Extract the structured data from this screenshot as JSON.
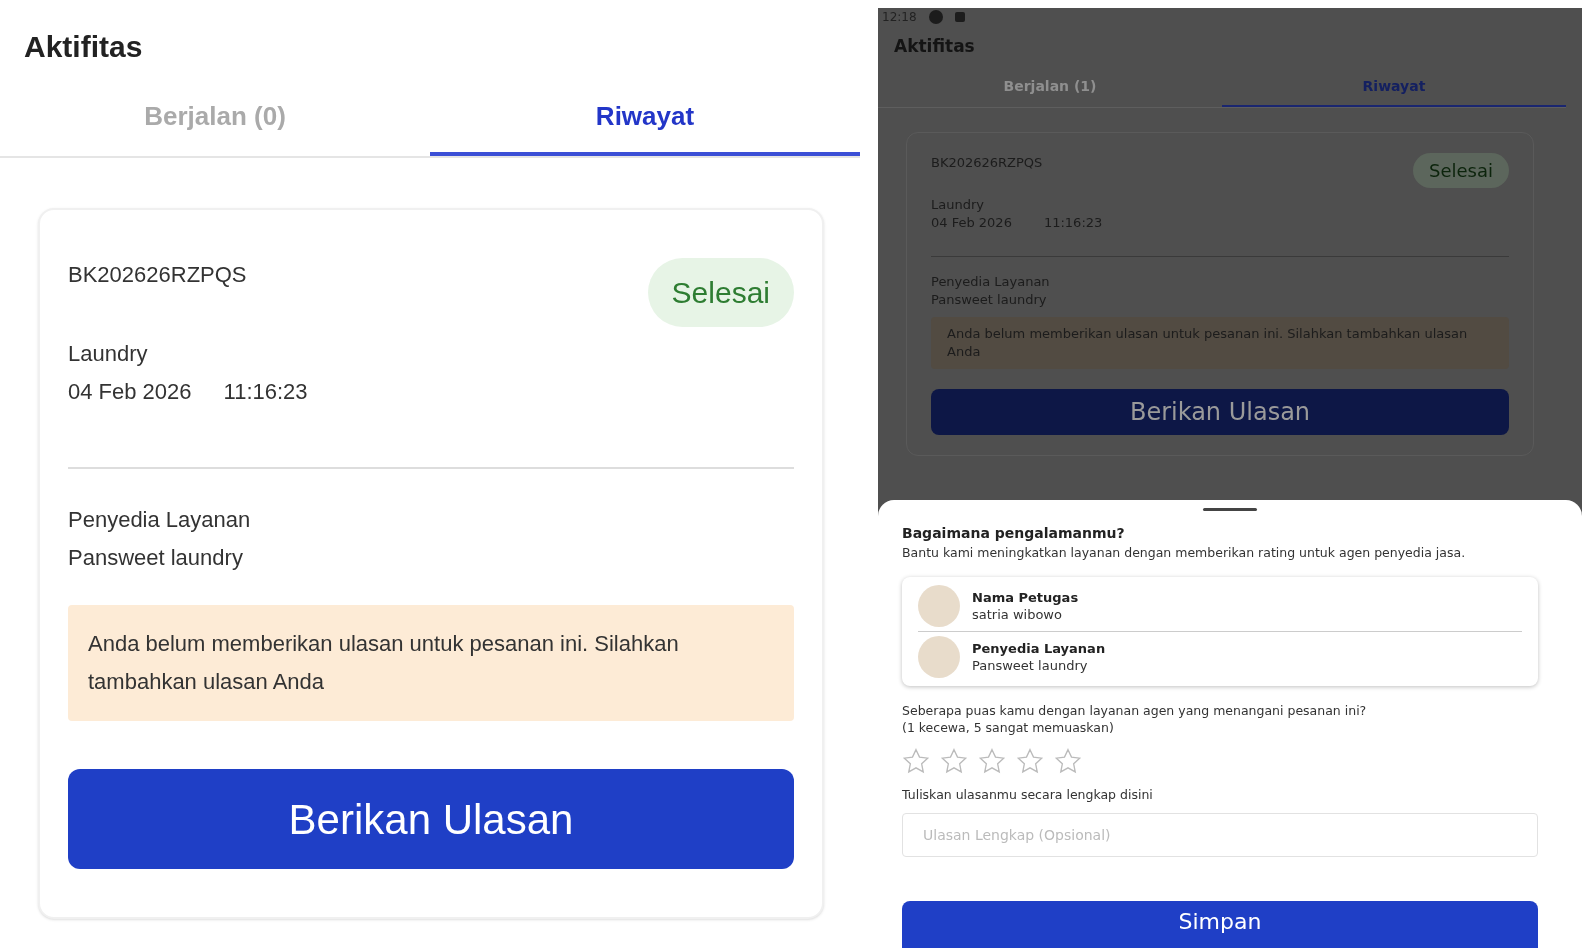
{
  "left": {
    "title": "Aktifitas",
    "tabs": [
      {
        "label": "Berjalan (0)",
        "selected": false
      },
      {
        "label": "Riwayat",
        "selected": true
      }
    ],
    "order": {
      "id": "BK202626RZPQS",
      "status": "Selesai",
      "category": "Laundry",
      "date": "04 Feb 2026",
      "time": "11:16:23",
      "provider_label": "Penyedia Layanan",
      "provider_name": "Pansweet laundry",
      "notice": "Anda belum memberikan ulasan untuk pesanan ini. Silahkan tambahkan ulasan Anda",
      "button": "Berikan Ulasan"
    }
  },
  "right": {
    "status_bar": {
      "time": "12:18"
    },
    "title": "Aktifitas",
    "tabs": [
      {
        "label": "Berjalan (1)",
        "selected": false
      },
      {
        "label": "Riwayat",
        "selected": true
      }
    ],
    "order": {
      "id": "BK202626RZPQS",
      "status": "Selesai",
      "category": "Laundry",
      "date": "04 Feb 2026",
      "time": "11:16:23",
      "provider_label": "Penyedia Layanan",
      "provider_name": "Pansweet laundry",
      "notice": "Anda belum memberikan ulasan untuk pesanan ini. Silahkan tambahkan ulasan Anda",
      "button": "Berikan Ulasan"
    },
    "sheet": {
      "title": "Bagaimana pengalamanmu?",
      "description": "Bantu kami meningkatkan layanan dengan memberikan rating untuk agen penyedia jasa.",
      "people": [
        {
          "label": "Nama Petugas",
          "value": "satria wibowo"
        },
        {
          "label": "Penyedia Layanan",
          "value": "Pansweet laundry"
        }
      ],
      "question": "Seberapa puas kamu dengan layanan agen yang menangani pesanan ini?",
      "scale": "(1 kecewa, 5 sangat memuaskan)",
      "stars": 0,
      "review_label": "Tuliskan ulasanmu secara lengkap disini",
      "review_placeholder": "Ulasan Lengkap (Opsional)",
      "button": "Simpan"
    }
  }
}
